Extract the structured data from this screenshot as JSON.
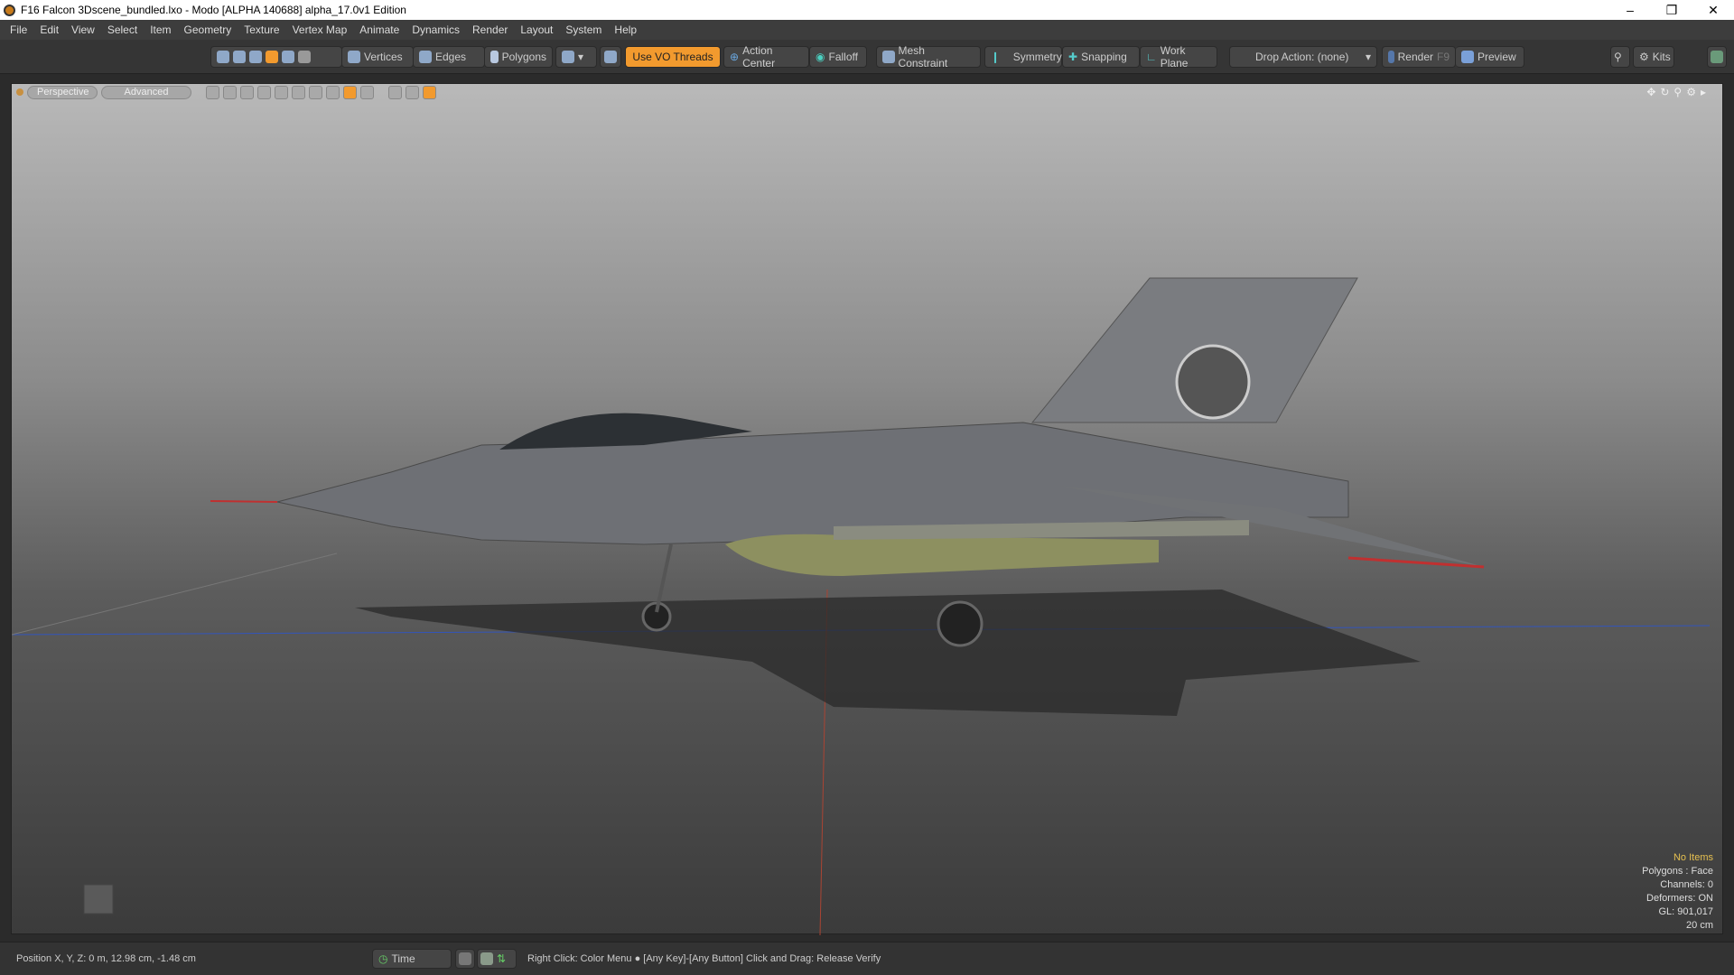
{
  "window": {
    "title": "F16 Falcon 3Dscene_bundled.lxo - Modo [ALPHA 140688]   alpha_17.0v1 Edition",
    "controls": [
      "minimize",
      "restore",
      "close"
    ]
  },
  "menu": [
    "File",
    "Edit",
    "View",
    "Select",
    "Item",
    "Geometry",
    "Texture",
    "Vertex Map",
    "Animate",
    "Dynamics",
    "Render",
    "Layout",
    "System",
    "Help"
  ],
  "toolbar": {
    "vertices": "Vertices",
    "edges": "Edges",
    "polygons": "Polygons",
    "use_vo_threads": "Use VO Threads",
    "action_center": "Action Center",
    "falloff": "Falloff",
    "mesh_constraint": "Mesh Constraint",
    "symmetry": "Symmetry",
    "snapping": "Snapping",
    "work_plane": "Work Plane",
    "drop_action": "Drop Action: (none)",
    "render": "Render",
    "render_key": "F9",
    "preview": "Preview",
    "kits": "Kits",
    "accent": "#f29a2e"
  },
  "viewport": {
    "view_mode": "Perspective",
    "shading": "Advanced"
  },
  "info": {
    "selection": "No Items",
    "polygons": "Polygons : Face",
    "channels": "Channels: 0",
    "deformers": "Deformers: ON",
    "gl": "GL: 901,017",
    "scale": "20 cm"
  },
  "status": {
    "position": "Position X, Y, Z:   0 m, 12.98 cm, -1.48 cm",
    "time": "Time",
    "hint": "Right Click: Color Menu ● [Any Key]-[Any Button] Click and Drag: Release Verify"
  }
}
